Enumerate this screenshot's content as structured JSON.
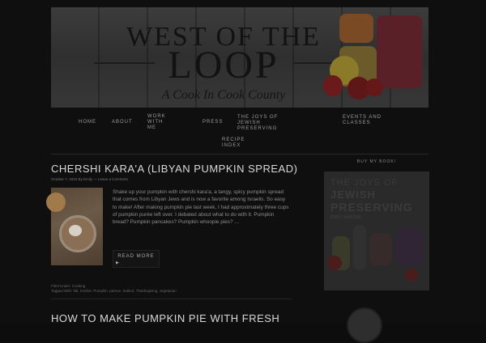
{
  "header": {
    "brand_top": "WEST OF THE",
    "brand_main": "LOOP",
    "brand_sub": "A Cook In Cook County"
  },
  "nav": {
    "home": "HOME",
    "about": "ABOUT",
    "work_with_me": "WORK WITH ME",
    "press": "PRESS",
    "joys": "THE JOYS OF JEWISH PRESERVING",
    "events": "EVENTS AND CLASSES",
    "recipe_index": "RECIPE INDEX"
  },
  "post": {
    "title": "CHERSHI KARA'A (LIBYAN PUMPKIN SPREAD)",
    "meta": "October 7, 2015 By Emily — Leave a Comment",
    "excerpt": "Shake up your pumpkin with chershi kara'a, a tangy, spicy pumpkin spread that comes from Libyan Jews and is now a favorite among Israelis. So easy to make! After making pumpkin pie last week, I had approximately three cups of pumpkin purée left over. I debated about what to do with it. Pumpkin bread? Pumpkin pancakes? Pumpkin whoopie pies? …",
    "read_more": "READ MORE",
    "arrow": "▶",
    "filed_under": "Filed Under: Cooking",
    "tagged_with": "Tagged With: fall, Kosher, Pumpkin, pareve, Sukkot, Thanksgiving, vegetarian"
  },
  "post2": {
    "title": "HOW TO MAKE PUMPKIN PIE WITH FRESH"
  },
  "sidebar": {
    "buy_label": "BUY MY BOOK!",
    "book_line1": "THE JOYS OF",
    "book_line2": "JEWISH",
    "book_line3": "PRESERVING",
    "book_author": "EMILY PAISTER"
  }
}
